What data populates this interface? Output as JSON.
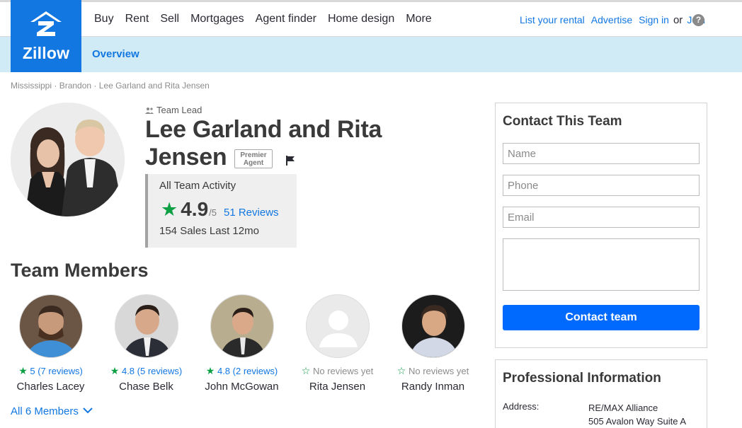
{
  "header": {
    "logo_text": "Zillow",
    "nav": [
      "Buy",
      "Rent",
      "Sell",
      "Mortgages",
      "Agent finder",
      "Home design",
      "More"
    ],
    "utility": {
      "list_rental": "List your rental",
      "advertise": "Advertise",
      "sign_in": "Sign in",
      "or": "or",
      "join": "Join",
      "help": "?"
    }
  },
  "subnav": {
    "overview": "Overview"
  },
  "breadcrumb": [
    "Mississippi",
    "Brandon",
    "Lee Garland and Rita Jensen"
  ],
  "profile": {
    "role": "Team Lead",
    "name": "Lee Garland and Rita Jensen",
    "badge_line1": "Premier",
    "badge_line2": "Agent",
    "activity": {
      "title": "All Team Activity",
      "score": "4.9",
      "out_of": "/5",
      "reviews": "51 Reviews",
      "sales": "154 Sales Last 12mo"
    }
  },
  "team": {
    "title": "Team Members",
    "members": [
      {
        "rating": "5 (7 reviews)",
        "name": "Charles Lacey",
        "has_reviews": true
      },
      {
        "rating": "4.8 (5 reviews)",
        "name": "Chase Belk",
        "has_reviews": true
      },
      {
        "rating": "4.8 (2 reviews)",
        "name": "John McGowan",
        "has_reviews": true
      },
      {
        "rating": "No reviews yet",
        "name": "Rita Jensen",
        "has_reviews": false
      },
      {
        "rating": "No reviews yet",
        "name": "Randy Inman",
        "has_reviews": false
      }
    ],
    "all_members": "All 6 Members"
  },
  "contact": {
    "title": "Contact This Team",
    "name_placeholder": "Name",
    "phone_placeholder": "Phone",
    "email_placeholder": "Email",
    "message_placeholder": "",
    "button": "Contact team"
  },
  "professional": {
    "title": "Professional Information",
    "address_label": "Address:",
    "address_line1": "RE/MAX Alliance",
    "address_line2": "505 Avalon Way Suite A"
  },
  "colors": {
    "brand": "#1277e1",
    "button": "#006aff",
    "star": "#0c9f44",
    "subnav_bg": "#d1ebf6"
  }
}
